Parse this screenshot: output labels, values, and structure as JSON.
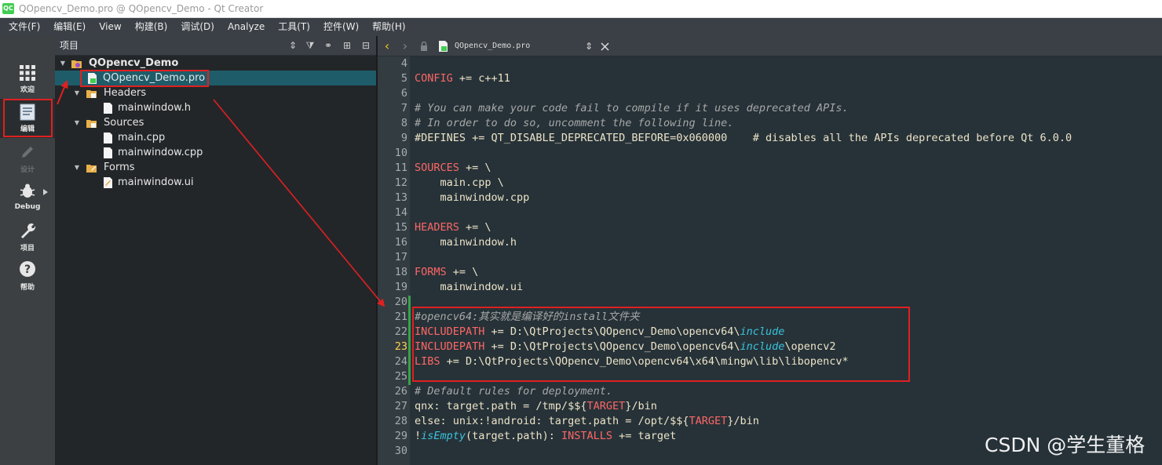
{
  "window": {
    "title": "QOpencv_Demo.pro @ QOpencv_Demo - Qt Creator",
    "logo": "QC"
  },
  "menu": [
    "文件(F)",
    "编辑(E)",
    "View",
    "构建(B)",
    "调试(D)",
    "Analyze",
    "工具(T)",
    "控件(W)",
    "帮助(H)"
  ],
  "modes": {
    "welcome": "欢迎",
    "edit": "编辑",
    "design": "设计",
    "debug": "Debug",
    "projects": "项目",
    "help": "帮助"
  },
  "project_pane": {
    "title": "项目",
    "tree": {
      "root": "QOpencv_Demo",
      "pro_file": "QOpencv_Demo.pro",
      "headers": "Headers",
      "header_file": "mainwindow.h",
      "sources": "Sources",
      "source_main": "main.cpp",
      "source_mainwindow": "mainwindow.cpp",
      "forms": "Forms",
      "form_file": "mainwindow.ui"
    }
  },
  "editor": {
    "file_name": "QOpencv_Demo.pro",
    "current_line": 23,
    "line_numbers": [
      "4",
      "5",
      "6",
      "7",
      "8",
      "9",
      "10",
      "11",
      "12",
      "13",
      "14",
      "15",
      "16",
      "17",
      "18",
      "19",
      "20",
      "21",
      "22",
      "23",
      "24",
      "25",
      "26",
      "27",
      "28",
      "29",
      "30"
    ],
    "tokens": {
      "l5a": "CONFIG",
      "l5b": " += c++11",
      "l7": "# You can make your code fail to compile if it uses deprecated APIs.",
      "l8": "# In order to do so, uncomment the following line.",
      "l9": "#DEFINES += QT_DISABLE_DEPRECATED_BEFORE=0x060000    # disables all the APIs deprecated before Qt 6.0.0",
      "l11a": "SOURCES",
      "l11b": " += \\",
      "l12": "    main.cpp \\",
      "l13": "    mainwindow.cpp",
      "l15a": "HEADERS",
      "l15b": " += \\",
      "l16": "    mainwindow.h",
      "l18a": "FORMS",
      "l18b": " += \\",
      "l19": "    mainwindow.ui",
      "l21": "#opencv64:其实就是编译好的install文件夹",
      "l22a": "INCLUDEPATH",
      "l22b": " += D:\\QtProjects\\QOpencv_Demo\\opencv64\\",
      "l22c": "include",
      "l23a": "INCLUDEPATH",
      "l23b": " += D:\\QtProjects\\QOpencv_Demo\\opencv64\\",
      "l23c": "include",
      "l23d": "\\opencv2",
      "l24a": "LIBS",
      "l24b": " += D:\\QtProjects\\QOpencv_Demo\\opencv64\\x64\\mingw\\lib\\libopencv*",
      "l26": "# Default rules for deployment.",
      "l27a": "qnx: target.path = /tmp/$${",
      "l27b": "TARGET",
      "l27c": "}/bin",
      "l28a": "else: unix:!android: target.path = /opt/$${",
      "l28b": "TARGET",
      "l28c": "}/bin",
      "l29a": "!",
      "l29b": "isEmpty",
      "l29c": "(target.path): ",
      "l29d": "INSTALLS",
      "l29e": " += target"
    }
  },
  "watermark": "CSDN @学生董格",
  "colors": {
    "annotation_red": "#e02020",
    "keyword": "#ff6666",
    "function": "#39c3dc",
    "comment": "#a8a8a8",
    "selection": "#1f5c6a"
  }
}
